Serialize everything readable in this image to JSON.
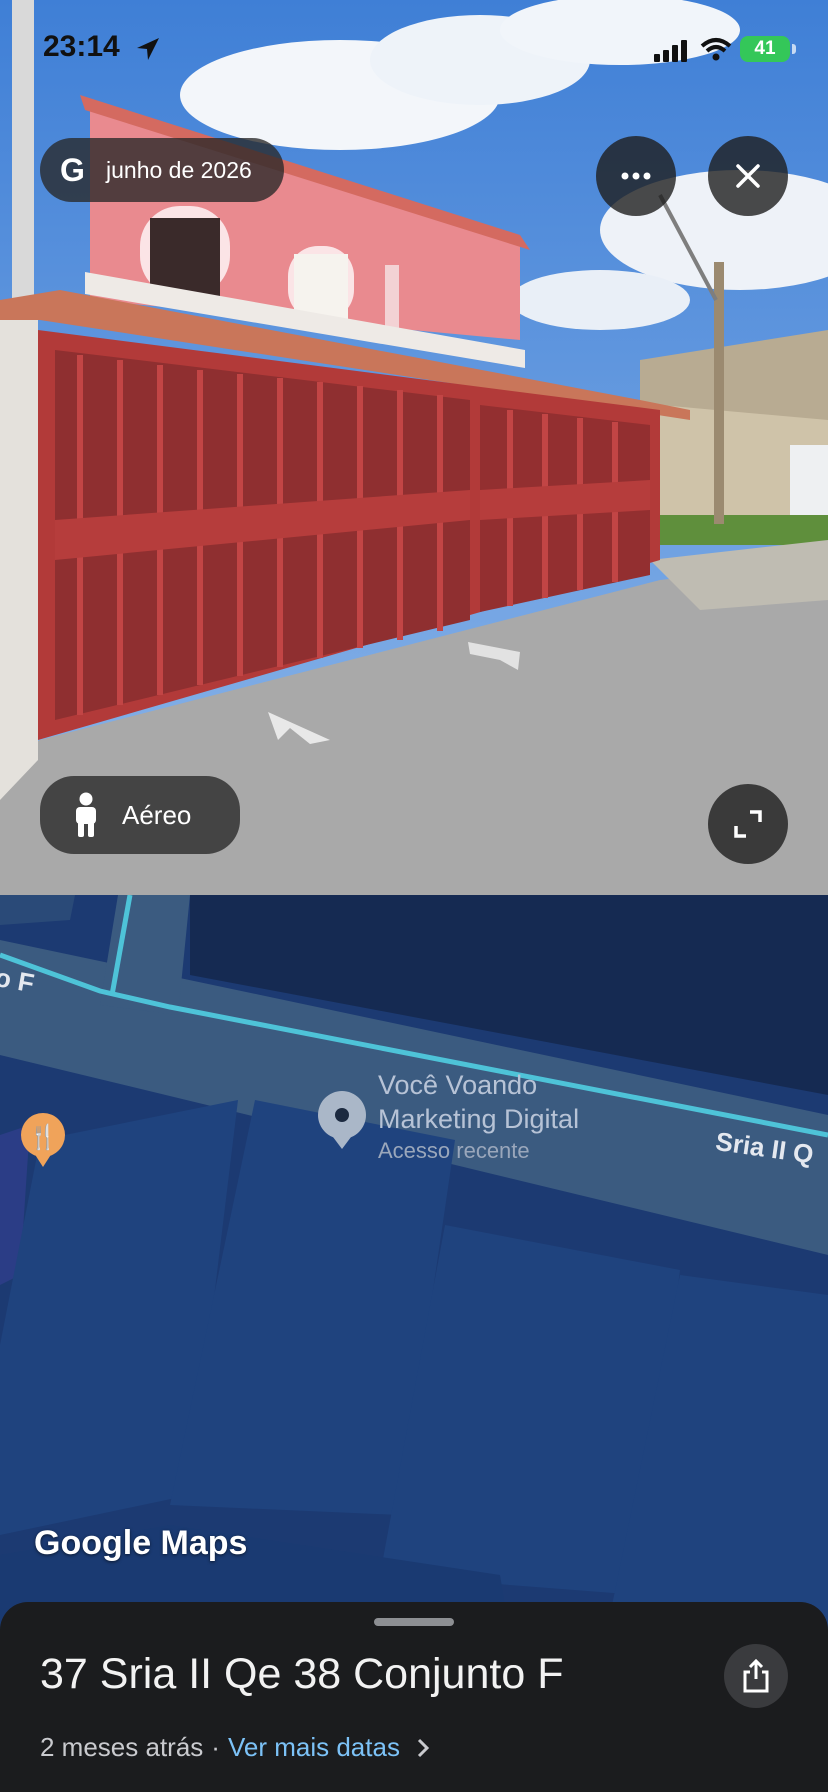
{
  "status_bar": {
    "time": "23:14",
    "battery": "41"
  },
  "street_view": {
    "logo": "G",
    "date_label": "junho de 2026",
    "more_icon": "ellipsis-icon",
    "close_icon": "close-icon",
    "aerial_label": "Aéreo",
    "expand_icon": "expand-icon"
  },
  "map": {
    "poi_name_line1": "Você Voando",
    "poi_name_line2": "Marketing Digital",
    "poi_subtitle": "Acesso recente",
    "street_right": "Sria II Q",
    "street_left": "o F",
    "brand": "Google Maps",
    "colors": {
      "background": "#1c3a72",
      "road": "#3b5b80",
      "block": "#1f437e"
    }
  },
  "bottom_sheet": {
    "address": "37 Sria II Qe 38 Conjunto F",
    "age": "2 meses atrás",
    "separator": "·",
    "more_dates": "Ver mais datas"
  }
}
